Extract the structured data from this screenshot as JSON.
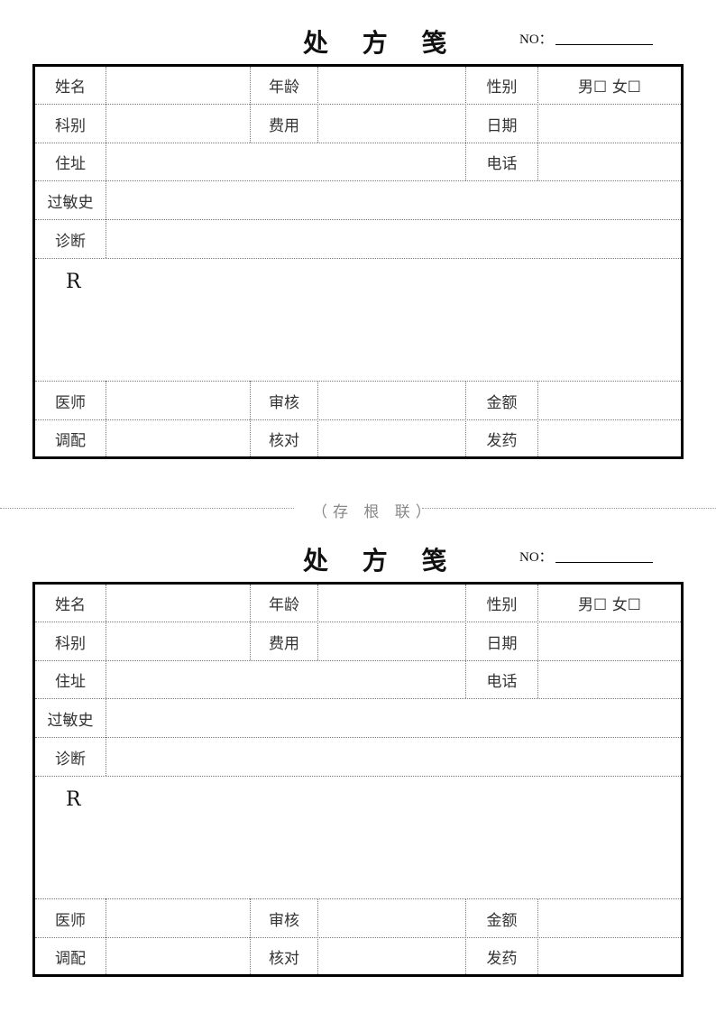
{
  "forms": [
    {
      "title": "处 方 笺",
      "no_label": "NO：",
      "labels": {
        "name": "姓名",
        "age": "年龄",
        "gender": "性别",
        "gender_options": "男☐  女☐",
        "department": "科别",
        "fee": "费用",
        "date": "日期",
        "address": "住址",
        "phone": "电话",
        "allergy": "过敏史",
        "diagnosis": "诊断",
        "rx": "R",
        "physician": "医师",
        "review": "审核",
        "amount": "金额",
        "dispense": "调配",
        "check": "核对",
        "issue": "发药"
      }
    },
    {
      "title": "处 方 笺",
      "no_label": "NO：",
      "labels": {
        "name": "姓名",
        "age": "年龄",
        "gender": "性别",
        "gender_options": "男☐  女☐",
        "department": "科别",
        "fee": "费用",
        "date": "日期",
        "address": "住址",
        "phone": "电话",
        "allergy": "过敏史",
        "diagnosis": "诊断",
        "rx": "R",
        "physician": "医师",
        "review": "审核",
        "amount": "金额",
        "dispense": "调配",
        "check": "核对",
        "issue": "发药"
      }
    }
  ],
  "divider": {
    "label": "（存 根 联）"
  }
}
